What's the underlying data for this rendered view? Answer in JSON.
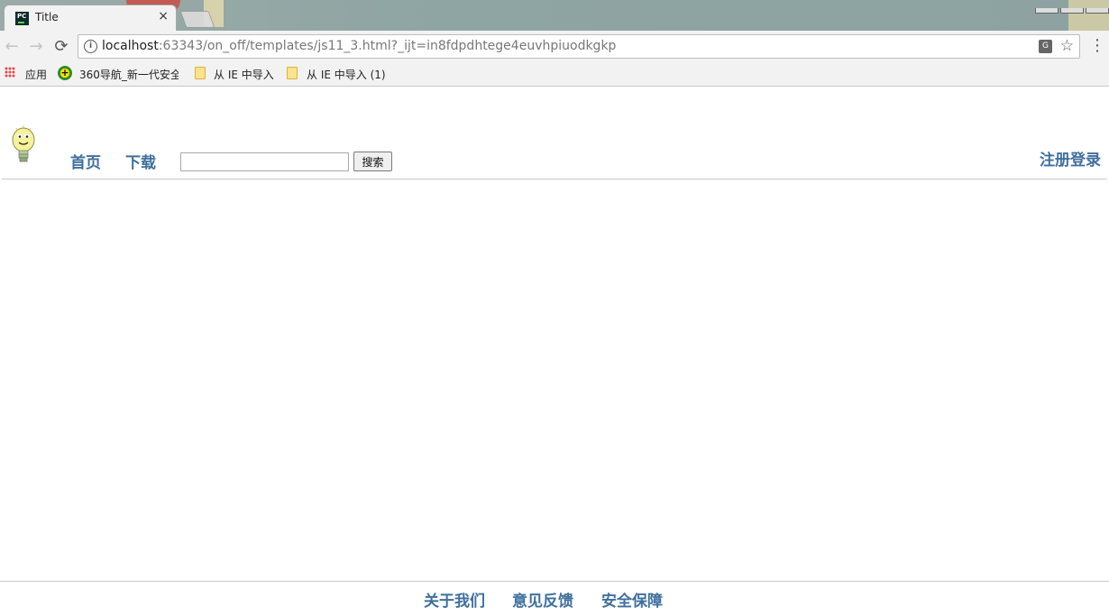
{
  "browser": {
    "tab": {
      "title": "Title",
      "close": "×"
    },
    "nav": {
      "back": "←",
      "forward": "→",
      "reload": "⟳"
    },
    "address": {
      "host": "localhost",
      "rest": ":63343/on_off/templates/js11_3.html?_ijt=in8fdpdhtege4euvhpiuodkgkp"
    },
    "bookmarks": [
      {
        "label": "应用",
        "icon": "apps-grid-icon"
      },
      {
        "label": "360导航_新一代安全",
        "icon": "globe-360-icon"
      },
      {
        "label": "从 IE 中导入",
        "icon": "folder-icon"
      },
      {
        "label": "从 IE 中导入 (1)",
        "icon": "folder-icon"
      }
    ]
  },
  "header": {
    "logo_icon": "lightbulb-mascot-icon",
    "nav": {
      "home": "首页",
      "download": "下载"
    },
    "search": {
      "value": "",
      "placeholder": "",
      "button": "搜索"
    },
    "register_login": "注册登录"
  },
  "footer": {
    "links": {
      "about": "关于我们",
      "feedback": "意见反馈",
      "safety": "安全保障"
    }
  },
  "colors": {
    "link": "#3f6f9d",
    "rule": "#c9c9c9",
    "chrome": "#f2f2f2"
  }
}
